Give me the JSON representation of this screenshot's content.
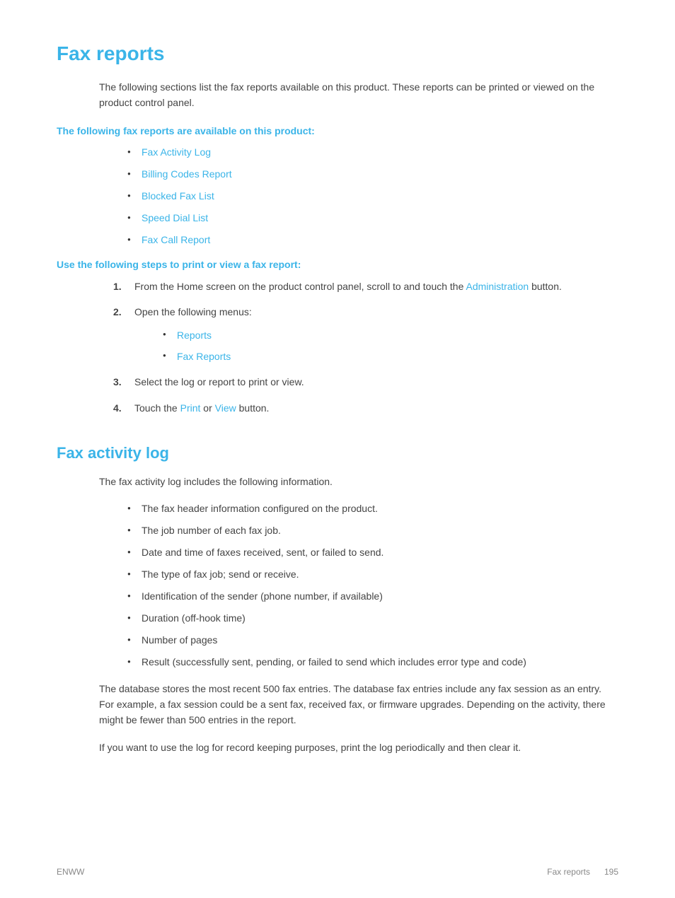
{
  "page": {
    "title": "Fax reports",
    "intro": "The following sections list the fax reports available on this product. These reports can be printed or viewed on the product control panel.",
    "subheading1": "The following fax reports are available on this product:",
    "reports_list": [
      {
        "label": "Fax Activity Log",
        "link": true
      },
      {
        "label": "Billing Codes Report",
        "link": true
      },
      {
        "label": "Blocked Fax List",
        "link": true
      },
      {
        "label": "Speed Dial List",
        "link": true
      },
      {
        "label": "Fax Call Report",
        "link": true
      }
    ],
    "subheading2": "Use the following steps to print or view a fax report:",
    "steps": [
      {
        "num": "1.",
        "text_before": "From the Home screen on the product control panel, scroll to and touch the ",
        "link_text": "Administration",
        "text_after": " button."
      },
      {
        "num": "2.",
        "text_before": "Open the following menus:",
        "nested": [
          {
            "label": "Reports",
            "link": true
          },
          {
            "label": "Fax Reports",
            "link": true
          }
        ]
      },
      {
        "num": "3.",
        "text_before": "Select the log or report to print or view.",
        "link_text": null,
        "text_after": null
      },
      {
        "num": "4.",
        "text_before": "Touch the ",
        "link_text": "Print",
        "text_middle": " or ",
        "link_text2": "View",
        "text_after": " button."
      }
    ],
    "section2_title": "Fax activity log",
    "section2_intro": "The fax activity log includes the following information.",
    "activity_list": [
      "The fax header information configured on the product.",
      "The job number of each fax job.",
      "Date and time of faxes received, sent, or failed to send.",
      "The type of fax job; send or receive.",
      "Identification of the sender (phone number, if available)",
      "Duration (off-hook time)",
      "Number of pages",
      "Result (successfully sent, pending, or failed to send which includes error type and code)"
    ],
    "body_text1": "The database stores the most recent 500 fax entries. The database fax entries include any fax session as an entry. For example, a fax session could be a sent fax, received fax, or firmware upgrades. Depending on the activity, there might be fewer than 500 entries in the report.",
    "body_text2": "If you want to use the log for record keeping purposes, print the log periodically and then clear it.",
    "footer": {
      "left": "ENWW",
      "right_label": "Fax reports",
      "page_num": "195"
    }
  },
  "colors": {
    "accent": "#3ab4e8",
    "text": "#444444",
    "footer": "#888888"
  }
}
